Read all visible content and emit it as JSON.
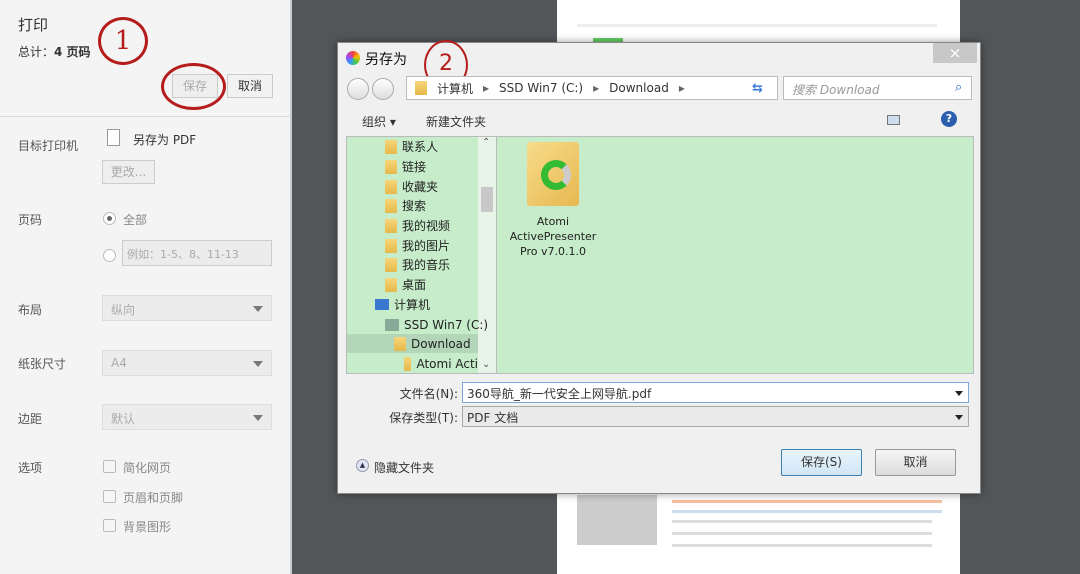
{
  "print_panel": {
    "title": "打印",
    "total_label": "总计：",
    "total_value": "4 页码",
    "save_button": "保存",
    "cancel_button": "取消",
    "destination_label": "目标打印机",
    "destination_value": "另存为 PDF",
    "change_button": "更改...",
    "pages_label": "页码",
    "pages_all": "全部",
    "pages_placeholder": "例如：1-5、8、11-13",
    "layout_label": "布局",
    "layout_value": "纵向",
    "paper_label": "纸张尺寸",
    "paper_value": "A4",
    "margin_label": "边距",
    "margin_value": "默认",
    "options_label": "选项",
    "options": [
      "简化网页",
      "页眉和页脚",
      "背景图形"
    ]
  },
  "annotations": {
    "one": "1",
    "two": "2"
  },
  "dialog": {
    "title": "另存为",
    "close": "×",
    "breadcrumb": [
      "计算机",
      "SSD Win7 (C:)",
      "Download"
    ],
    "search_placeholder": "搜索 Download",
    "organize": "组织 ▾",
    "new_folder": "新建文件夹",
    "tree": [
      "联系人",
      "链接",
      "收藏夹",
      "搜索",
      "我的视频",
      "我的图片",
      "我的音乐",
      "桌面",
      "计算机",
      "SSD Win7 (C:)",
      "Download",
      "Atomi Acti"
    ],
    "file_item": [
      "Atomi",
      "ActivePresenter",
      "Pro v7.0.1.0"
    ],
    "filename_label": "文件名(N):",
    "filename_value": "360导航_新一代安全上网导航.pdf",
    "filetype_label": "保存类型(T):",
    "filetype_value": "PDF 文档",
    "hide_folders": "隐藏文件夹",
    "save_button": "保存(S)",
    "cancel_button": "取消"
  }
}
